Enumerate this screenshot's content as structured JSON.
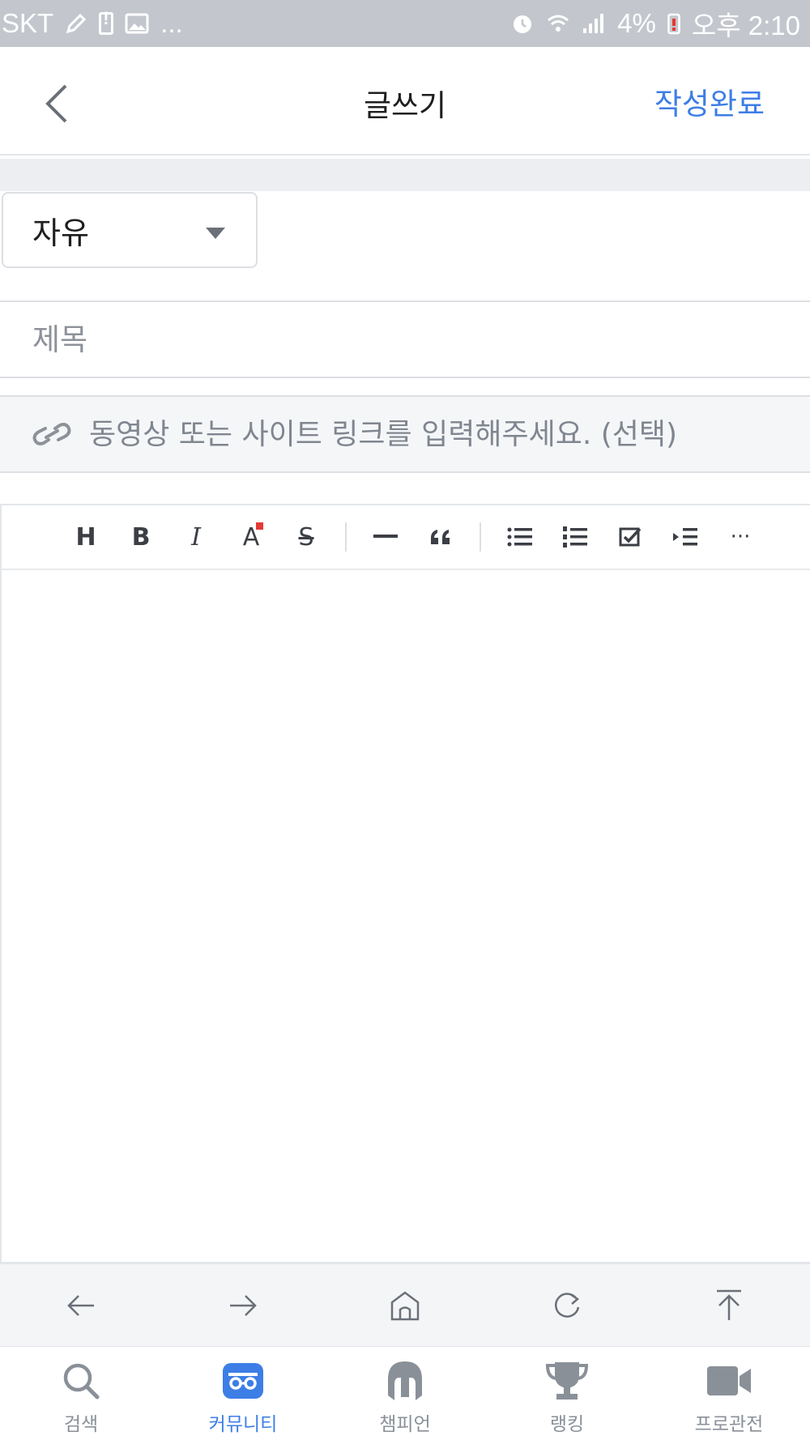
{
  "status_bar": {
    "carrier": "SKT",
    "more": "...",
    "battery": "4%",
    "time": "오후 2:10"
  },
  "header": {
    "title": "글쓰기",
    "done_label": "작성완료"
  },
  "form": {
    "category": "자유",
    "title_placeholder": "제목",
    "link_placeholder": "동영상 또는 사이트 링크를 입력해주세요. (선택)"
  },
  "toolbar": {
    "heading": "H",
    "bold": "B",
    "italic": "I",
    "color": "A",
    "strike": "S",
    "more": "···"
  },
  "tabs": [
    {
      "label": "검색",
      "icon": "search-icon"
    },
    {
      "label": "커뮤니티",
      "icon": "community-icon"
    },
    {
      "label": "챔피언",
      "icon": "champion-icon"
    },
    {
      "label": "랭킹",
      "icon": "trophy-icon"
    },
    {
      "label": "프로관전",
      "icon": "video-camera-icon"
    }
  ],
  "colors": {
    "accent": "#3d7ee6",
    "status_bar": "#c3c7cd",
    "tab_inactive": "#8a9098"
  }
}
